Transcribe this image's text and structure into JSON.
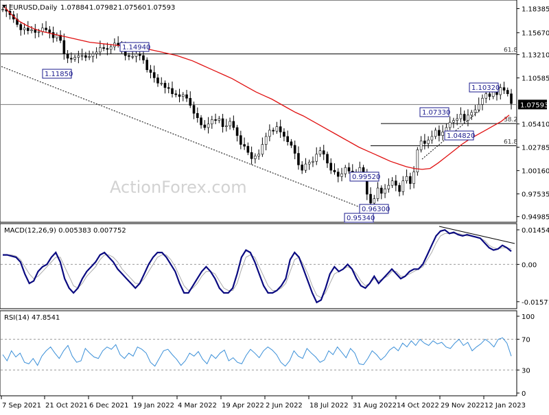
{
  "chart_data": [
    {
      "type": "candlestick",
      "title": "EURUSD,Daily",
      "ohlc_header": [
        "1.07884",
        "1.07982",
        "1.07560",
        "1.07593"
      ],
      "watermark": "ActionForex.com",
      "y_ticks": [
        "1.18385",
        "1.15670",
        "1.13210",
        "1.10585",
        "1.07593",
        "1.05410",
        "1.02785",
        "1.00160",
        "0.97535",
        "0.94985"
      ],
      "ylim": [
        0.945,
        1.192
      ],
      "last_price": "1.07593",
      "annotations": [
        "1.14940",
        "1.11850",
        "1.10320",
        "1.07330",
        "1.04820",
        "0.99520",
        "0.96300",
        "0.95340"
      ],
      "fib_labels": [
        "61.8",
        "38.2",
        "61.8"
      ],
      "fib_levels": [
        1.1329,
        1.0545,
        1.0295
      ],
      "overlays": [
        "moving average (red)",
        "dashed trend line",
        "horizontal support/resistance lines"
      ],
      "close_series": [
        1.183,
        1.181,
        1.177,
        1.172,
        1.166,
        1.16,
        1.162,
        1.159,
        1.16,
        1.157,
        1.158,
        1.162,
        1.16,
        1.157,
        1.151,
        1.154,
        1.148,
        1.133,
        1.128,
        1.127,
        1.129,
        1.131,
        1.131,
        1.129,
        1.13,
        1.133,
        1.135,
        1.14,
        1.139,
        1.138,
        1.141,
        1.145,
        1.143,
        1.14,
        1.131,
        1.13,
        1.13,
        1.133,
        1.131,
        1.126,
        1.115,
        1.112,
        1.106,
        1.1,
        1.1,
        1.095,
        1.094,
        1.088,
        1.087,
        1.085,
        1.087,
        1.083,
        1.075,
        1.066,
        1.061,
        1.053,
        1.05,
        1.054,
        1.059,
        1.058,
        1.06,
        1.051,
        1.052,
        1.057,
        1.05,
        1.041,
        1.031,
        1.029,
        1.022,
        1.015,
        1.018,
        1.02,
        1.031,
        1.04,
        1.047,
        1.046,
        1.051,
        1.045,
        1.04,
        1.034,
        1.03,
        1.021,
        1.008,
        1.002,
        1.009,
        1.011,
        1.012,
        1.02,
        1.024,
        1.02,
        1.01,
        1.002,
        1.0,
        0.995,
        0.998,
        1.005,
        1.001,
        0.997,
        0.999,
        1.005,
        0.998,
        0.975,
        0.965,
        0.97,
        0.982,
        0.976,
        0.981,
        0.985,
        0.99,
        0.985,
        0.978,
        0.99,
        0.995,
        0.987,
        1.0,
        1.025,
        1.035,
        1.032,
        1.036,
        1.04,
        1.047,
        1.041,
        1.045,
        1.05,
        1.056,
        1.058,
        1.06,
        1.065,
        1.058,
        1.064,
        1.067,
        1.07,
        1.076,
        1.083,
        1.088,
        1.085,
        1.09,
        1.087,
        1.095,
        1.092,
        1.088,
        1.077
      ],
      "ma_series": [
        1.188,
        1.178,
        1.17,
        1.165,
        1.161,
        1.158,
        1.156,
        1.154,
        1.152,
        1.15,
        1.148,
        1.146,
        1.145,
        1.144,
        1.143,
        1.142,
        1.141,
        1.14,
        1.139,
        1.137,
        1.135,
        1.133,
        1.131,
        1.128,
        1.125,
        1.121,
        1.117,
        1.113,
        1.109,
        1.105,
        1.1,
        1.095,
        1.09,
        1.086,
        1.082,
        1.077,
        1.072,
        1.067,
        1.063,
        1.058,
        1.053,
        1.048,
        1.043,
        1.038,
        1.033,
        1.028,
        1.024,
        1.02,
        1.016,
        1.012,
        1.009,
        1.006,
        1.004,
        1.003,
        1.004,
        1.01,
        1.017,
        1.024,
        1.031,
        1.037,
        1.042,
        1.047,
        1.052,
        1.057,
        1.064
      ]
    },
    {
      "type": "line",
      "title": "MACD(12,26,9) 0.005383 0.007752",
      "y_ticks": [
        "0.014549",
        "0.00",
        "-0.015712"
      ],
      "ylim": [
        -0.0175,
        0.016
      ],
      "series": [
        {
          "name": "MACD",
          "values": [
            0.004,
            0.004,
            0.0035,
            0.003,
            0.001,
            -0.004,
            -0.008,
            -0.007,
            -0.003,
            -0.001,
            0.0,
            0.003,
            0.005,
            0.001,
            -0.006,
            -0.01,
            -0.012,
            -0.01,
            -0.006,
            -0.003,
            -0.001,
            0.001,
            0.004,
            0.005,
            0.003,
            0.001,
            -0.002,
            -0.004,
            -0.006,
            -0.008,
            -0.01,
            -0.008,
            -0.004,
            0.0,
            0.003,
            0.005,
            0.005,
            0.003,
            0.0,
            -0.003,
            -0.008,
            -0.012,
            -0.012,
            -0.009,
            -0.006,
            -0.003,
            -0.001,
            -0.003,
            -0.006,
            -0.01,
            -0.012,
            -0.012,
            -0.01,
            -0.004,
            0.003,
            0.006,
            0.005,
            0.001,
            -0.004,
            -0.009,
            -0.012,
            -0.012,
            -0.011,
            -0.009,
            -0.006,
            0.002,
            0.005,
            0.003,
            -0.002,
            -0.007,
            -0.012,
            -0.016,
            -0.015,
            -0.01,
            -0.004,
            -0.001,
            -0.003,
            -0.002,
            0.0,
            -0.002,
            -0.006,
            -0.009,
            -0.01,
            -0.008,
            -0.005,
            -0.008,
            -0.006,
            -0.004,
            -0.002,
            -0.004,
            -0.006,
            -0.005,
            -0.003,
            -0.002,
            -0.002,
            0.0,
            0.004,
            0.008,
            0.012,
            0.014,
            0.0145,
            0.013,
            0.0135,
            0.0125,
            0.012,
            0.0125,
            0.012,
            0.0115,
            0.011,
            0.009,
            0.007,
            0.006,
            0.0065,
            0.008,
            0.007,
            0.0055
          ]
        },
        {
          "name": "Signal",
          "values": [
            0.004,
            0.004,
            0.004,
            0.0035,
            0.002,
            -0.001,
            -0.004,
            -0.006,
            -0.005,
            -0.003,
            -0.001,
            0.001,
            0.003,
            0.003,
            -0.001,
            -0.005,
            -0.009,
            -0.01,
            -0.008,
            -0.005,
            -0.003,
            -0.001,
            0.002,
            0.004,
            0.004,
            0.003,
            0.001,
            -0.002,
            -0.004,
            -0.006,
            -0.008,
            -0.008,
            -0.006,
            -0.003,
            0.0,
            0.003,
            0.004,
            0.004,
            0.002,
            -0.001,
            -0.005,
            -0.009,
            -0.011,
            -0.01,
            -0.008,
            -0.005,
            -0.003,
            -0.003,
            -0.004,
            -0.007,
            -0.01,
            -0.011,
            -0.011,
            -0.008,
            -0.002,
            0.003,
            0.004,
            0.003,
            -0.001,
            -0.005,
            -0.009,
            -0.011,
            -0.011,
            -0.01,
            -0.008,
            -0.003,
            0.002,
            0.003,
            0.0,
            -0.004,
            -0.009,
            -0.013,
            -0.014,
            -0.012,
            -0.008,
            -0.004,
            -0.003,
            -0.002,
            -0.001,
            -0.002,
            -0.004,
            -0.007,
            -0.009,
            -0.008,
            -0.006,
            -0.007,
            -0.006,
            -0.005,
            -0.003,
            -0.003,
            -0.005,
            -0.005,
            -0.004,
            -0.003,
            -0.002,
            -0.001,
            0.002,
            0.005,
            0.009,
            0.012,
            0.013,
            0.013,
            0.013,
            0.013,
            0.0125,
            0.012,
            0.012,
            0.0115,
            0.011,
            0.01,
            0.008,
            0.007,
            0.0065,
            0.007,
            0.007,
            0.0065
          ]
        }
      ]
    },
    {
      "type": "line",
      "title": "RSI(14) 47.8541",
      "y_ticks": [
        "100",
        "70",
        "30",
        "0"
      ],
      "ylim": [
        0,
        100
      ],
      "series": [
        {
          "name": "RSI",
          "values": [
            50,
            42,
            55,
            47,
            52,
            40,
            38,
            45,
            36,
            48,
            55,
            60,
            52,
            45,
            55,
            62,
            48,
            40,
            42,
            58,
            52,
            47,
            45,
            55,
            60,
            57,
            63,
            50,
            45,
            52,
            48,
            60,
            57,
            52,
            40,
            35,
            45,
            55,
            57,
            50,
            44,
            36,
            42,
            52,
            48,
            54,
            44,
            38,
            50,
            45,
            52,
            56,
            42,
            46,
            40,
            38,
            49,
            57,
            52,
            46,
            55,
            60,
            56,
            50,
            40,
            35,
            42,
            55,
            48,
            45,
            58,
            52,
            47,
            40,
            43,
            55,
            50,
            60,
            53,
            46,
            58,
            52,
            38,
            37,
            45,
            55,
            50,
            43,
            48,
            56,
            60,
            55,
            65,
            60,
            68,
            62,
            70,
            65,
            62,
            68,
            64,
            66,
            60,
            58,
            65,
            70,
            62,
            66,
            55,
            60,
            64,
            70,
            66,
            60,
            70,
            72,
            65,
            48
          ]
        }
      ]
    }
  ],
  "x_axis_labels": [
    "7 Sep 2021",
    "21 Oct 2021",
    "6 Dec 2021",
    "19 Jan 2022",
    "4 Mar 2022",
    "19 Apr 2022",
    "2 Jun 2022",
    "18 Jul 2022",
    "31 Aug 2022",
    "14 Oct 2022",
    "29 Nov 2022",
    "12 Jan 2023"
  ]
}
